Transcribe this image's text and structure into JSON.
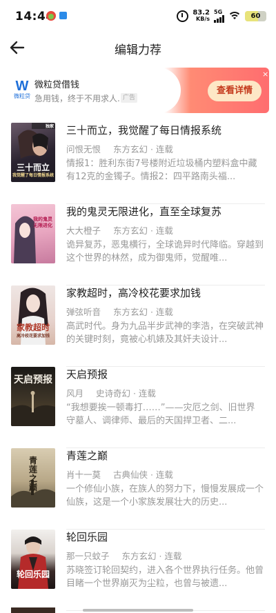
{
  "status_bar": {
    "time": "14:44",
    "net_speed_value": "83.2",
    "net_speed_unit": "KB/s",
    "network_type": "5G",
    "battery": "60",
    "icons": [
      "app-notification-icon",
      "app-notification-icon-2",
      "alarm-icon",
      "signal-icon",
      "wifi-icon",
      "battery-icon"
    ]
  },
  "header": {
    "title": "编辑力荐",
    "back_icon": "arrow-left-icon"
  },
  "ad": {
    "logo_text": "微粒贷",
    "title": "微粒贷借钱",
    "description": "急用钱，终于不用求人...",
    "tag": "广告",
    "cta": "查看详情",
    "close": "×"
  },
  "books": [
    {
      "title": "三十而立，我觉醒了每日情报系统",
      "author": "问恨无恨",
      "category": "东方玄幻 · 连载",
      "description": "情报1：胜利东街7号楼附近垃圾桶内塑料盒中藏有12克的金镯子。情报2：四平路南头福...",
      "cover_title": "三十而立",
      "cover_subtitle": "我觉醒了每日情报系统",
      "cover_badge": "独家"
    },
    {
      "title": "我的鬼灵无限进化，直至全球复苏",
      "author": "大大橙子",
      "category": "东方玄幻 · 连载",
      "description": "诡异复苏，恶鬼横行，全球诡异时代降临。穿越到这个世界的林然，成为御鬼师，觉醒唯...",
      "cover_title": "我的鬼灵无限进化"
    },
    {
      "title": "家教超时，高冷校花要求加钱",
      "author": "弹弦听音",
      "category": "东方玄幻 · 连载",
      "description": "高武时代。身为九品半步武神的李浩，在突破武神的关键时刻，竟被心机婊及其奸夫设计...",
      "cover_title": "家教超时",
      "cover_subtitle": "高冷校花要求加钱"
    },
    {
      "title": "天启预报",
      "author": "风月",
      "category": "史诗奇幻 · 连载",
      "description": "“我想要挨一顿毒打……”——灾厄之剑、旧世界守墓人、调律师、最后的天国捍卫者、二...",
      "cover_title": "天启预报"
    },
    {
      "title": "青莲之巅",
      "author": "肖十一莫",
      "category": "古典仙侠 · 连载",
      "description": "一个修仙小族，在族人的努力下，慢慢发展成一个仙族，这是一个小家族发展壮大的历史...",
      "cover_title": "青莲之巅"
    },
    {
      "title": "轮回乐园",
      "author": "那一只蚊子",
      "category": "东方玄幻 · 连载",
      "description": "苏晓签订轮回契约，进入各个世界执行任务。他曾目睹一个世界崩灭为尘粒，也曾与被遗...",
      "cover_title": "轮回乐园"
    }
  ]
}
